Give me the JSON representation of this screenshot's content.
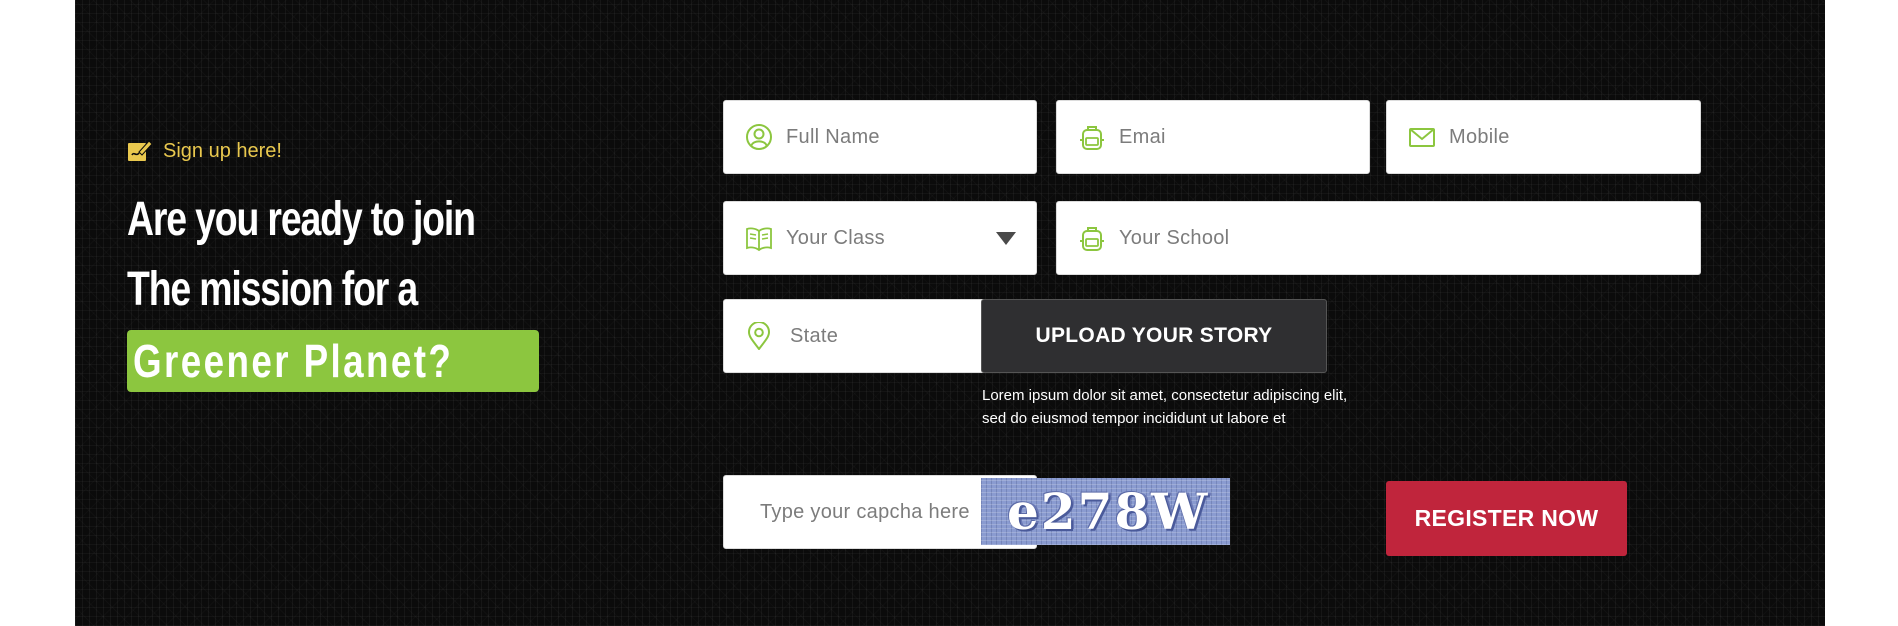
{
  "intro": {
    "signup_label": "Sign up here!",
    "headline_line1": "Are you ready to join",
    "headline_line2": "The mission for a",
    "highlight": "Greener Planet?",
    "signup_icon": "signup-edit-icon"
  },
  "form": {
    "full_name": {
      "placeholder": "Full Name",
      "icon": "user-icon"
    },
    "email": {
      "placeholder": "Emai",
      "icon": "backpack-icon"
    },
    "mobile": {
      "placeholder": "Mobile",
      "icon": "envelope-icon"
    },
    "class": {
      "selected": "Your Class",
      "icon": "book-icon"
    },
    "school": {
      "placeholder": "Your School",
      "icon": "backpack-icon"
    },
    "state": {
      "selected": "State",
      "icon": "location-pin-icon"
    },
    "upload_label": "UPLOAD YOUR STORY",
    "upload_note": "Lorem ipsum dolor sit amet, consectetur adipiscing elit, sed do eiusmod tempor incididunt ut labore et",
    "captcha_placeholder": "Type your capcha here",
    "captcha_text": "e278W",
    "register_label": "REGISTER NOW"
  },
  "colors": {
    "accent_green": "#8cc63f",
    "signup_yellow": "#e9c84e",
    "register_red": "#c0253c",
    "background": "#0b0b0b"
  }
}
